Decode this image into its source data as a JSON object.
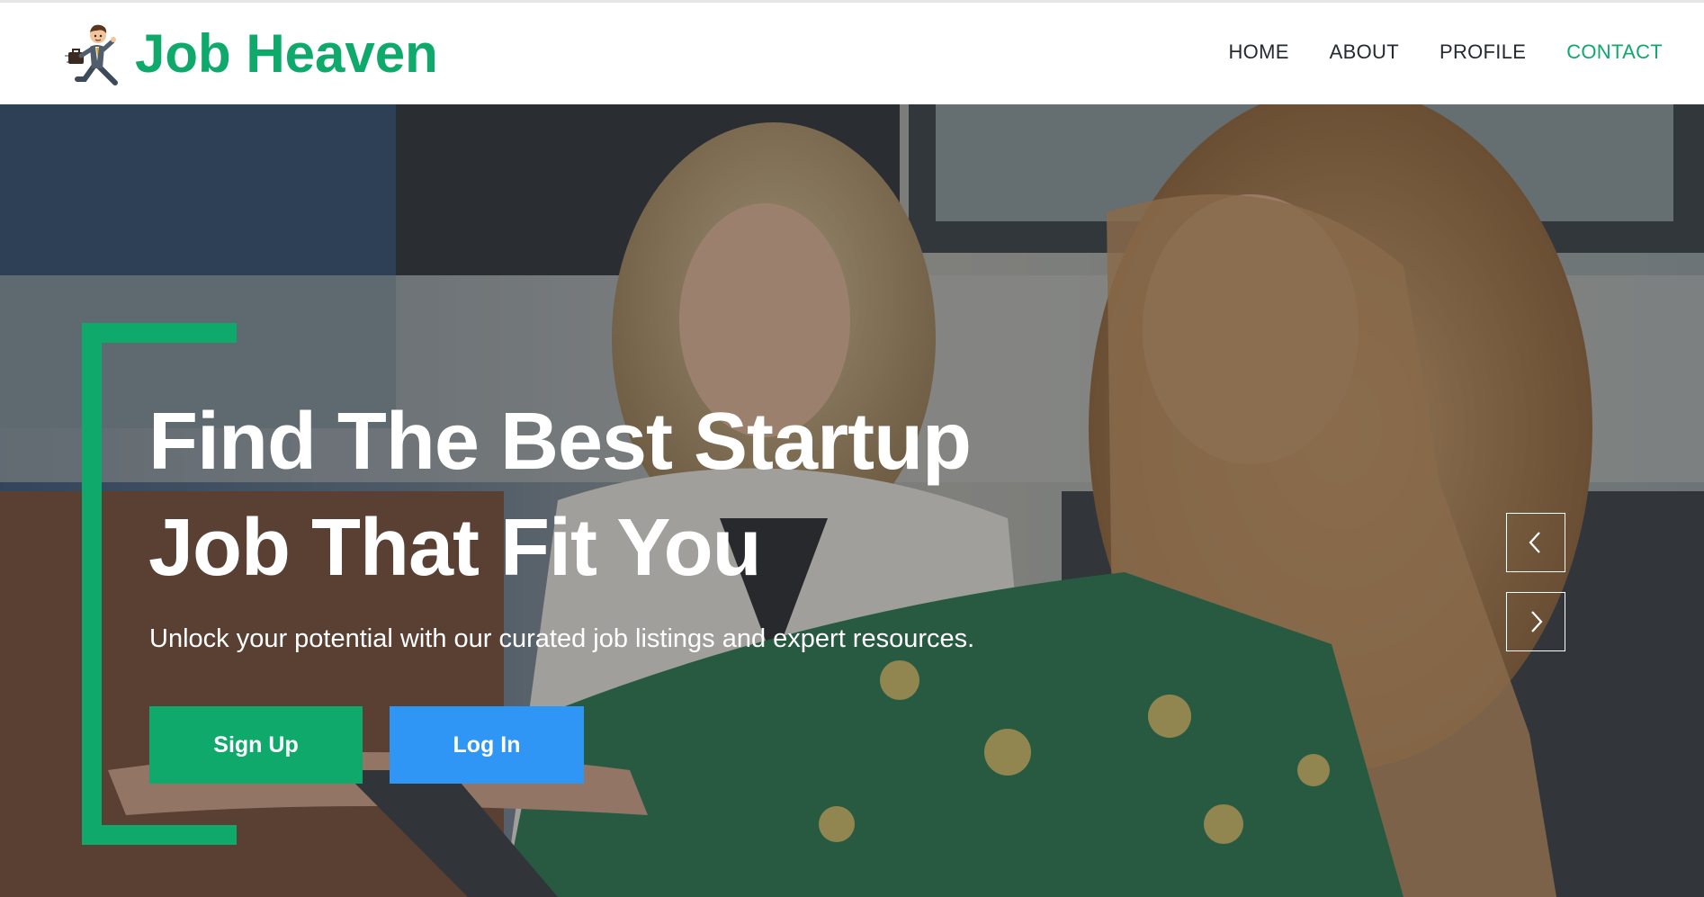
{
  "brand": {
    "name": "Job Heaven",
    "logo_icon": "running-businessman-icon",
    "color": "#0fa96c"
  },
  "nav": {
    "items": [
      {
        "label": "HOME",
        "active": false
      },
      {
        "label": "ABOUT",
        "active": false
      },
      {
        "label": "PROFILE",
        "active": false
      },
      {
        "label": "CONTACT",
        "active": true
      }
    ],
    "active_color": "#0fa96c"
  },
  "hero": {
    "headline_line1": "Find The Best Startup",
    "headline_line2": "Job That Fit You",
    "subtitle": "Unlock your potential with our curated job listings and expert resources.",
    "signup_label": "Sign Up",
    "login_label": "Log In",
    "signup_color": "#0fa96c",
    "login_color": "#2f96f6",
    "prev_icon": "chevron-left-icon",
    "next_icon": "chevron-right-icon"
  }
}
